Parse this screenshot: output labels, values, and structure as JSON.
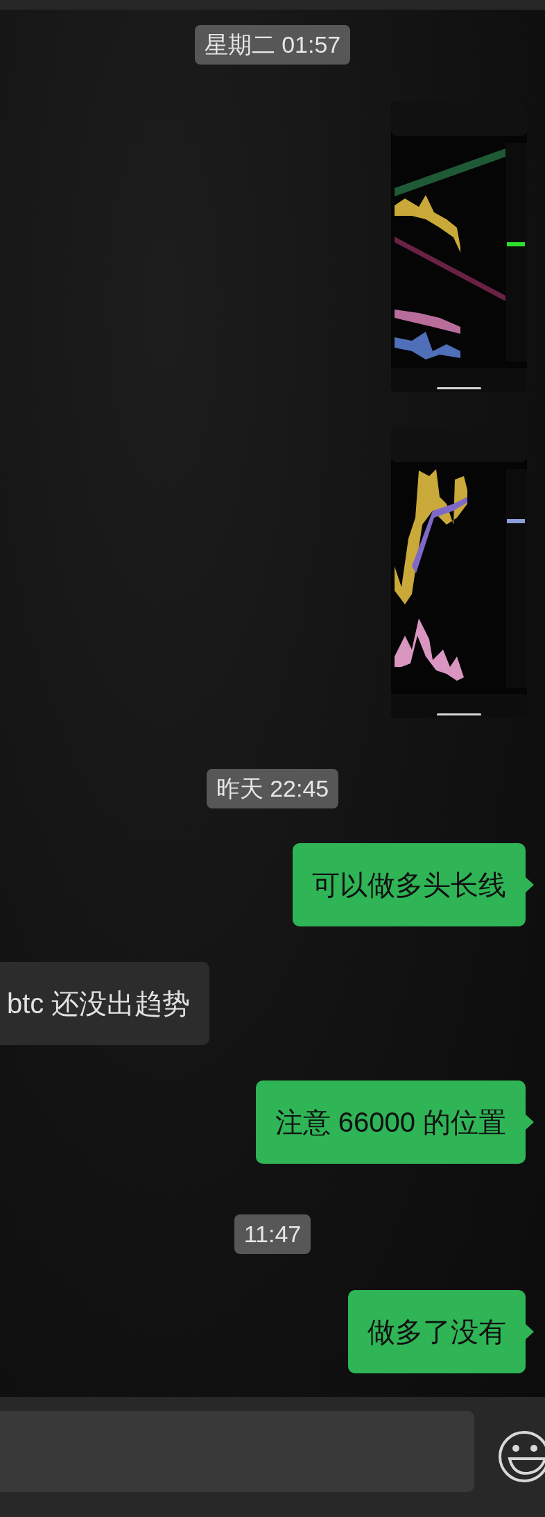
{
  "messages": [
    {
      "kind": "time",
      "text": "星期二 01:57"
    },
    {
      "kind": "picture"
    },
    {
      "kind": "picture"
    },
    {
      "kind": "time",
      "text": "昨天 22:45"
    },
    {
      "kind": "sent",
      "text": "可以做多头长线"
    },
    {
      "kind": "received",
      "text": "btc 还没出趋势"
    },
    {
      "kind": "sent",
      "text": "注意 66000 的位置"
    },
    {
      "kind": "time",
      "text": "11:47"
    },
    {
      "kind": "sent",
      "text": "做多了没有"
    }
  ]
}
